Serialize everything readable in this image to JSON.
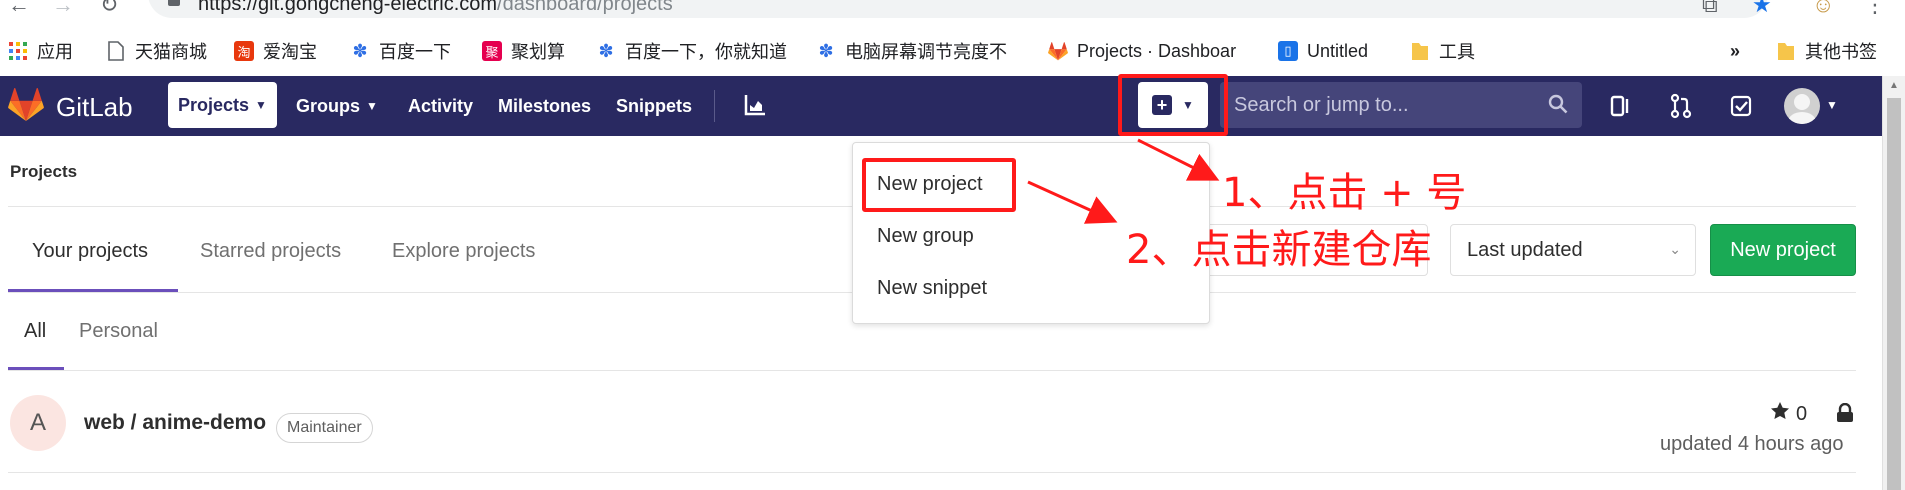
{
  "browser": {
    "address_url_host": "https://git.gongcheng-electric.com",
    "address_url_path": "/dashboard/projects",
    "bookmarks": [
      {
        "label": "应用",
        "icon": "apps-grid-icon"
      },
      {
        "label": "天猫商城",
        "icon": "page-icon"
      },
      {
        "label": "爱淘宝",
        "icon": "taobao-icon"
      },
      {
        "label": "百度一下",
        "icon": "baidu-paw-icon"
      },
      {
        "label": "聚划算",
        "icon": "juhuasuan-icon"
      },
      {
        "label": "百度一下，你就知道",
        "icon": "baidu-paw-icon"
      },
      {
        "label": "电脑屏幕调节亮度不",
        "icon": "baidu-paw-icon"
      },
      {
        "label": "Projects · Dashboar",
        "icon": "gitlab-icon"
      },
      {
        "label": "Untitled",
        "icon": "doc-icon"
      },
      {
        "label": "工具",
        "icon": "folder-icon"
      },
      {
        "label": "»",
        "icon": ""
      },
      {
        "label": "其他书签",
        "icon": "folder-icon"
      }
    ]
  },
  "navbar": {
    "logo_text": "GitLab",
    "items": [
      {
        "label": "Projects",
        "dropdown": true,
        "active": true
      },
      {
        "label": "Groups",
        "dropdown": true,
        "active": false
      },
      {
        "label": "Activity",
        "dropdown": false,
        "active": false
      },
      {
        "label": "Milestones",
        "dropdown": false,
        "active": false
      },
      {
        "label": "Snippets",
        "dropdown": false,
        "active": false
      }
    ],
    "search_placeholder": "Search or jump to..."
  },
  "page": {
    "breadcrumb": "Projects",
    "tabs": [
      "Your projects",
      "Starred projects",
      "Explore projects"
    ],
    "sort_value": "Last updated",
    "new_project_label": "New project",
    "subtabs": [
      "All",
      "Personal"
    ]
  },
  "project": {
    "avatar_letter": "A",
    "name": "web / anime-demo",
    "role": "Maintainer",
    "stars": "0",
    "updated": "updated 4 hours ago"
  },
  "dropdown": {
    "items": [
      "New project",
      "New group",
      "New snippet"
    ]
  },
  "annotations": {
    "step1": "1、点击 + 号",
    "step2": "2、点击新建仓库",
    "color": "#ff1a1a"
  },
  "colors": {
    "navbar": "#292961",
    "accent": "#6b4fbb",
    "success": "#1aaa55"
  }
}
